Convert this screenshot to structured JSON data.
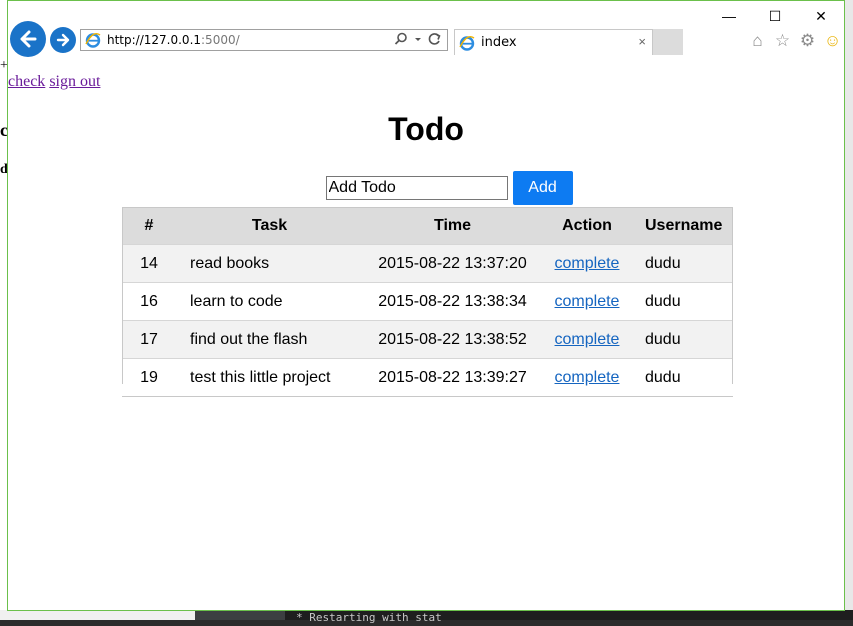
{
  "browser": {
    "url_host": "http://127.0.0.1",
    "url_rest": ":5000/",
    "tab_title": "index",
    "tab_close": "×",
    "window_controls": {
      "minimize": "—",
      "maximize": "☐",
      "close": "✕"
    }
  },
  "page": {
    "links": [
      "check",
      "sign out"
    ],
    "title": "Todo",
    "add_input_value": "Add Todo",
    "add_button": "Add",
    "table": {
      "headers": [
        "#",
        "Task",
        "Time",
        "Action",
        "Username"
      ],
      "rows": [
        {
          "id": "14",
          "task": "read books",
          "time": "2015-08-22 13:37:20",
          "action": "complete",
          "user": "dudu"
        },
        {
          "id": "16",
          "task": "learn to code",
          "time": "2015-08-22 13:38:34",
          "action": "complete",
          "user": "dudu"
        },
        {
          "id": "17",
          "task": "find out the flash",
          "time": "2015-08-22 13:38:52",
          "action": "complete",
          "user": "dudu"
        },
        {
          "id": "19",
          "task": "test this little project",
          "time": "2015-08-22 13:39:27",
          "action": "complete",
          "user": "dudu"
        }
      ]
    }
  },
  "background": {
    "terminal_text": "* Restarting with stat"
  },
  "colors": {
    "accent": "#0d7bf2",
    "link": "#1565c0",
    "visited_link": "#6a1b9a",
    "ie_blue": "#1a73c8",
    "window_border": "#6bc04b"
  }
}
